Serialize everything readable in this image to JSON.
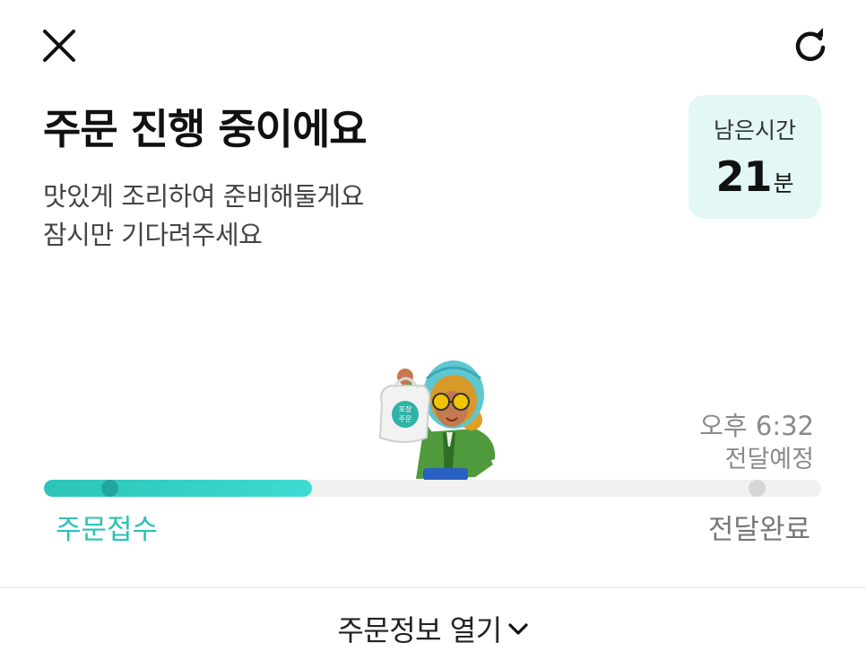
{
  "header": {
    "close_icon": "close-icon",
    "refresh_icon": "refresh-icon"
  },
  "status": {
    "title": "주문 진행 중이에요",
    "message_line1": "맛있게 조리하여 준비해둘게요",
    "message_line2": "잠시만 기다려주세요"
  },
  "remaining": {
    "label": "남은시간",
    "value": "21",
    "unit": "분"
  },
  "delivery": {
    "eta_time": "오후 6:32",
    "eta_label": "전달예정"
  },
  "progress": {
    "fraction": 0.345,
    "start_label": "주문접수",
    "end_label": "전달완료",
    "bag_text": "포장\n주문"
  },
  "bottom": {
    "toggle_label": "주문정보 열기",
    "toggle_icon": "chevron-down-icon"
  },
  "colors": {
    "accent": "#2cc4b8",
    "time_box_bg": "#e2f7f6",
    "track_bg": "#f1f1f1"
  }
}
